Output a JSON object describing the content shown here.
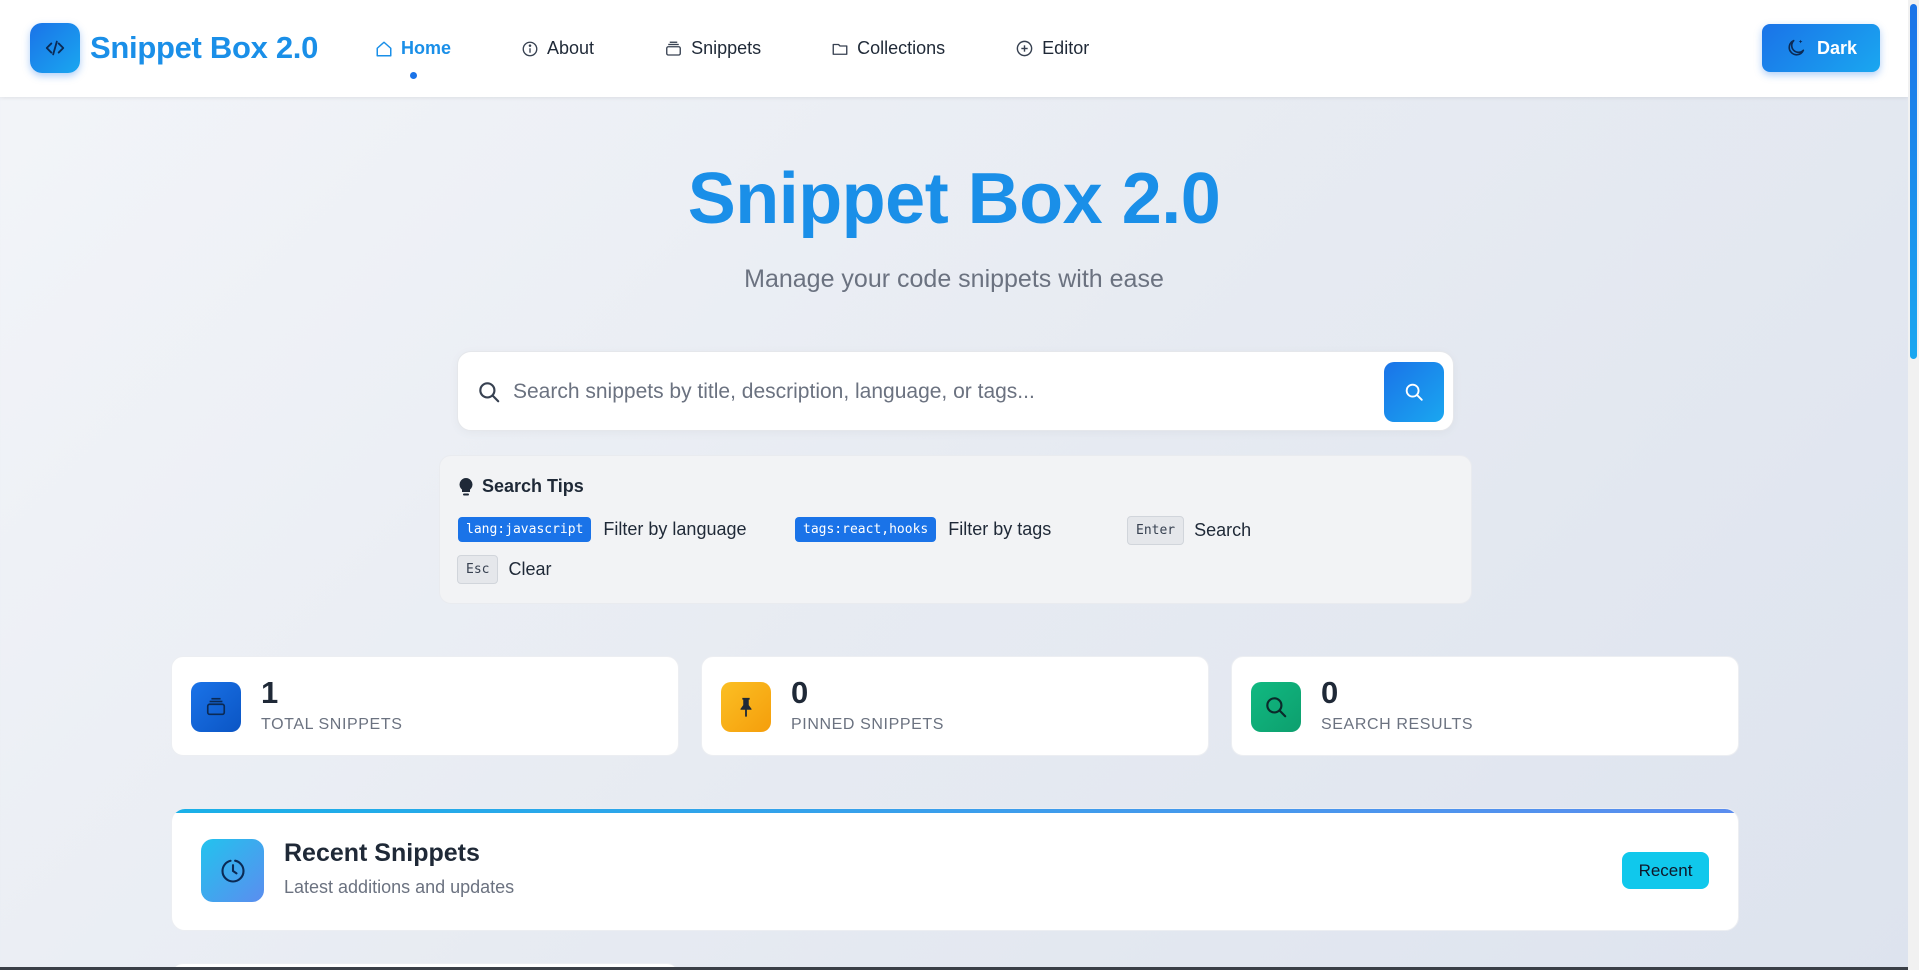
{
  "navbar": {
    "brand_title": "Snippet Box 2.0",
    "brand_icon": "code-icon",
    "items": [
      {
        "label": "Home",
        "icon": "home-icon",
        "active": true
      },
      {
        "label": "About",
        "icon": "info-icon",
        "active": false
      },
      {
        "label": "Snippets",
        "icon": "layers-icon",
        "active": false
      },
      {
        "label": "Collections",
        "icon": "folder-icon",
        "active": false
      },
      {
        "label": "Editor",
        "icon": "plus-circle-icon",
        "active": false
      }
    ],
    "theme_button_label": "Dark",
    "theme_button_icon": "moon-icon"
  },
  "hero": {
    "title": "Snippet Box 2.0",
    "subtitle": "Manage your code snippets with ease"
  },
  "search": {
    "placeholder": "Search snippets by title, description, language, or tags...",
    "value": ""
  },
  "tips": {
    "title": "Search Tips",
    "items": [
      {
        "chip": "lang:javascript",
        "text": "Filter by language",
        "style": "code"
      },
      {
        "chip": "tags:react,hooks",
        "text": "Filter by tags",
        "style": "code"
      },
      {
        "chip": "Enter",
        "text": "Search",
        "style": "kbd"
      },
      {
        "chip": "Esc",
        "text": "Clear",
        "style": "kbd"
      }
    ]
  },
  "stats": [
    {
      "value": "1",
      "label": "TOTAL SNIPPETS",
      "icon": "layers-icon"
    },
    {
      "value": "0",
      "label": "PINNED SNIPPETS",
      "icon": "pin-icon"
    },
    {
      "value": "0",
      "label": "SEARCH RESULTS",
      "icon": "search-icon"
    }
  ],
  "recent": {
    "title": "Recent Snippets",
    "subtitle": "Latest additions and updates",
    "badge": "Recent"
  },
  "colors": {
    "accent": "#1a73e8",
    "brand_text": "#1a8fe8",
    "pinned_icon_bg": "#f59e0b",
    "search_results_icon_bg": "#10b981",
    "recent_badge": "#10c8ec"
  }
}
